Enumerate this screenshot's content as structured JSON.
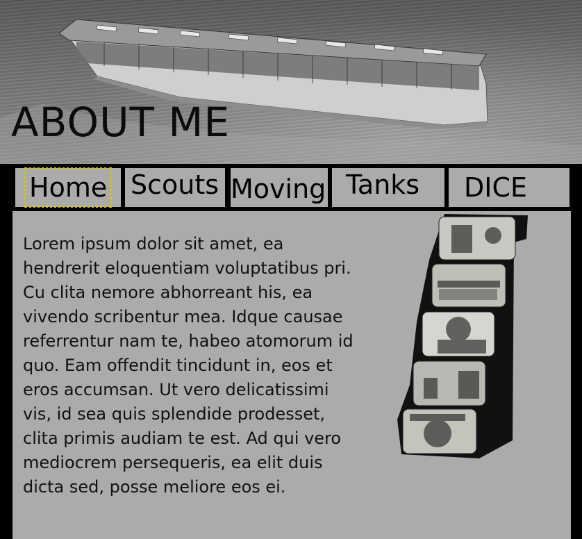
{
  "header": {
    "title": "ABOUT ME",
    "image_description": "ship-photo"
  },
  "nav": {
    "items": [
      {
        "label": "Home",
        "active": true
      },
      {
        "label": "Scouts",
        "active": false
      },
      {
        "label": "Moving",
        "active": false
      },
      {
        "label": "Tanks",
        "active": false
      },
      {
        "label": "DICE",
        "active": false
      }
    ]
  },
  "main": {
    "paragraph": "Lorem ipsum dolor sit amet, ea hendrerit eloquentiam voluptatibus pri. Cu clita nemore abhorreant his, ea vivendo scribentur mea. Idque causae referrentur nam te, habeo atomorum id quo. Eam offendit tincidunt in, eos et eros accumsan. Ut vero delicatissimi vis, id sea quis splendide prodesset, clita primis audiam te est. Ad qui vero mediocrem persequeris, ea elit duis dicta sed, posse meliore eos ei."
  },
  "colors": {
    "background": "#000000",
    "panel": "#ababab",
    "active_outline": "#d8c700"
  }
}
